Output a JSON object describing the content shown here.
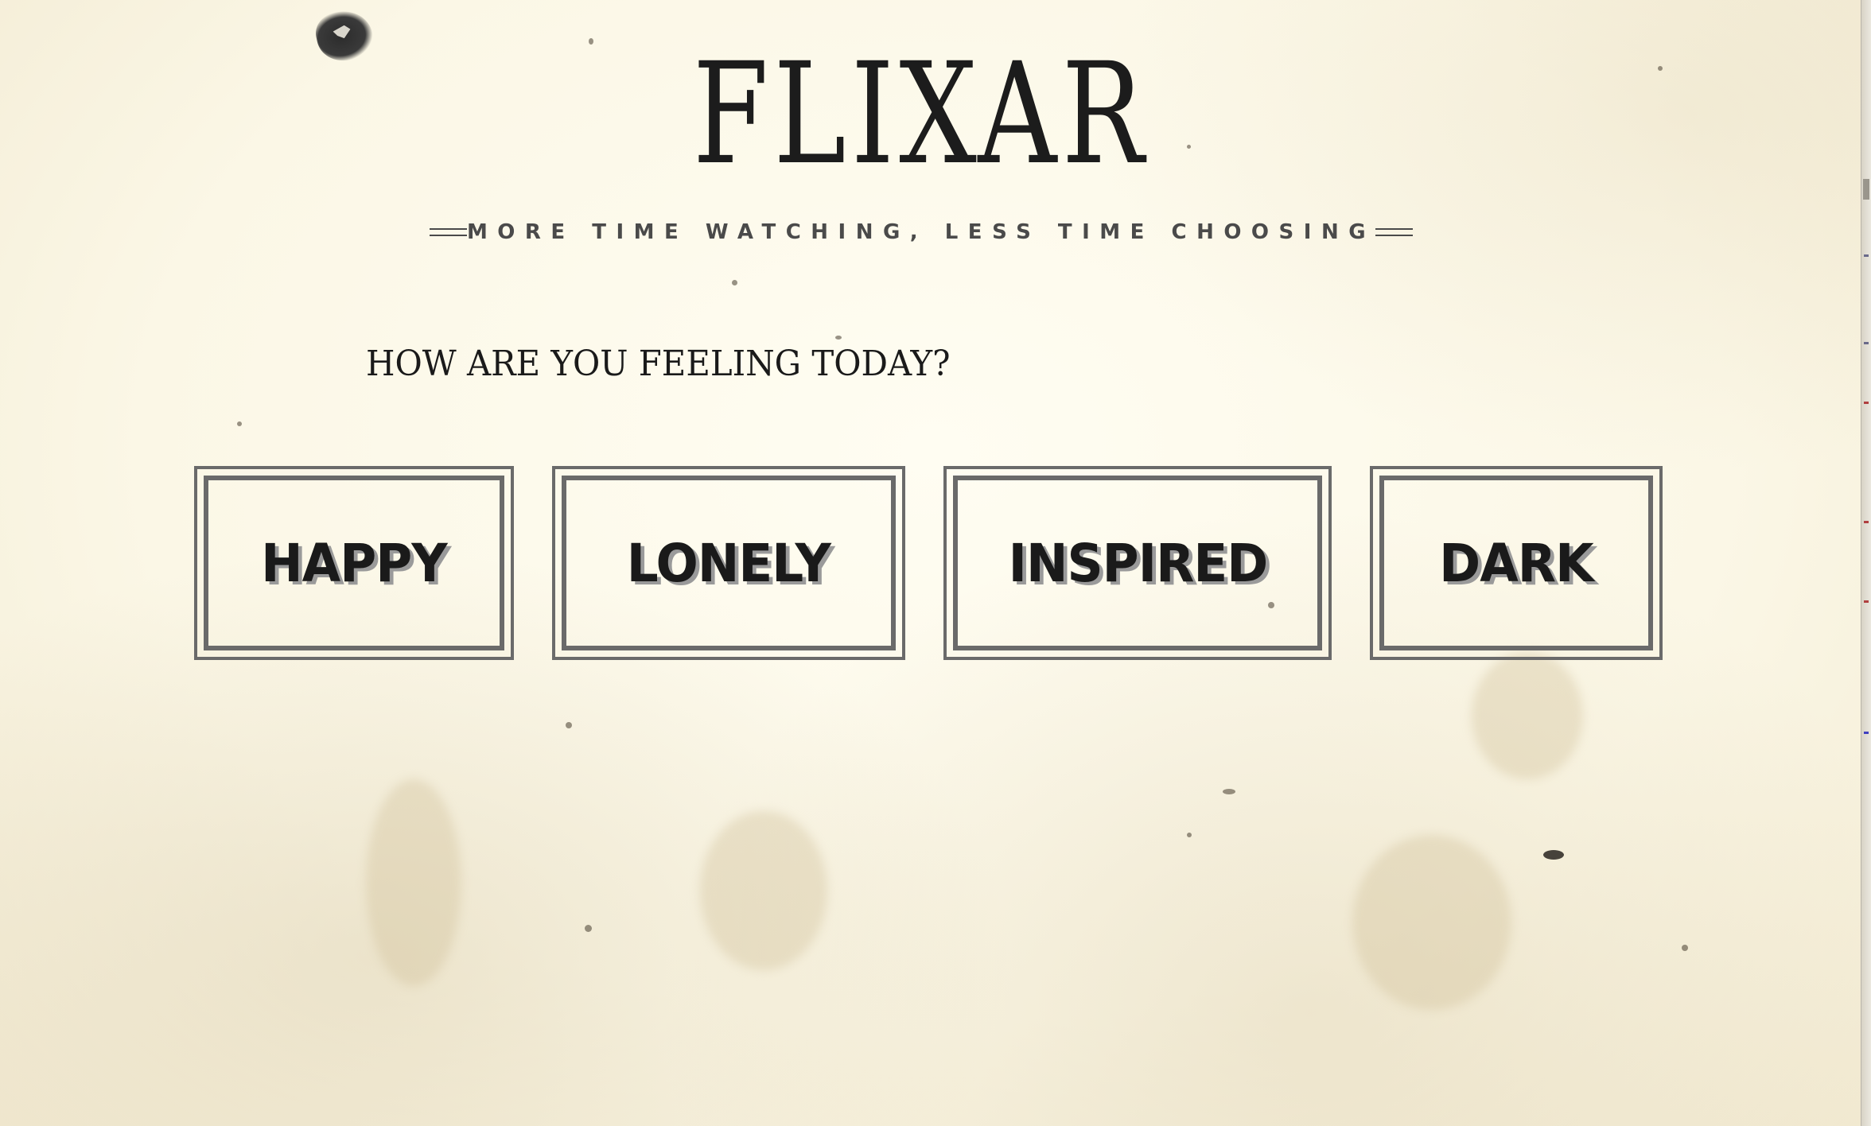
{
  "app": {
    "logo": "FLIXAR",
    "tagline": "MORE TIME WATCHING, LESS TIME CHOOSING"
  },
  "prompt": {
    "question": "HOW ARE YOU FEELING TODAY?"
  },
  "moods": [
    {
      "label": "HAPPY"
    },
    {
      "label": "LONELY"
    },
    {
      "label": "INSPIRED"
    },
    {
      "label": "DARK"
    }
  ],
  "colors": {
    "background": "#fcf8e8",
    "text": "#1a1a1a",
    "border": "#6a6a6a",
    "tagline": "#4a4a4a",
    "shadow": "#9a9a9a"
  }
}
